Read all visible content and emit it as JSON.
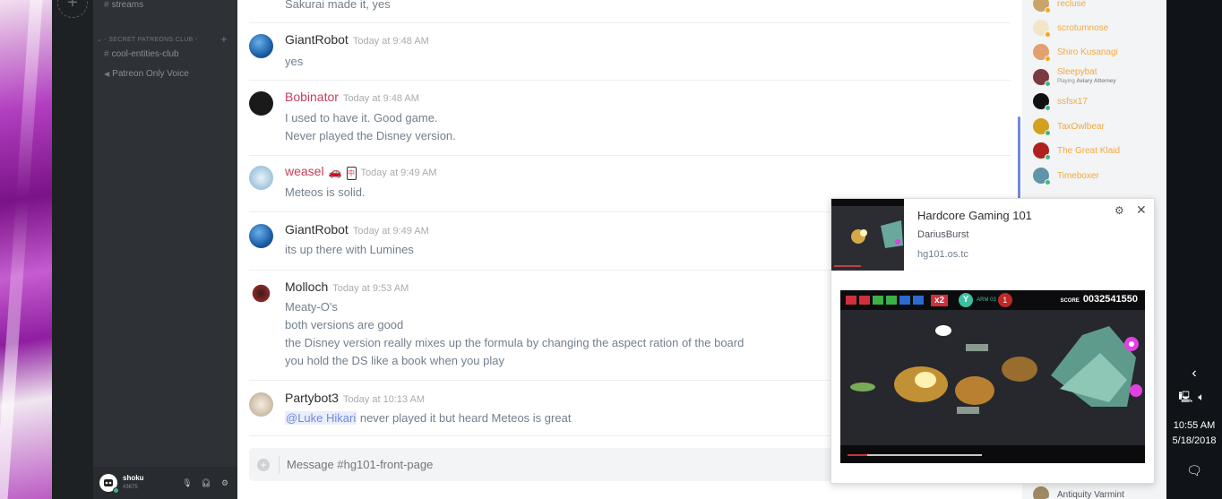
{
  "channels": {
    "top_item": "streams",
    "category": "- SECRET PATREONS CLUB -",
    "items": [
      {
        "label": "cool-entities-club"
      },
      {
        "label": "Patreon Only Voice"
      }
    ]
  },
  "user": {
    "name": "shoku",
    "tag": "#3675"
  },
  "messages": [
    {
      "name": "",
      "time": "",
      "lines": [
        "Sakurai made it, yes"
      ],
      "name_color": "#2d2f33"
    },
    {
      "name": "GiantRobot",
      "time": "Today at 9:48 AM",
      "lines": [
        "yes"
      ],
      "name_color": "#2d2f33"
    },
    {
      "name": "Bobinator",
      "time": "Today at 9:48 AM",
      "lines": [
        "I used to have it. Good game.",
        "Never played the Disney version."
      ],
      "name_color": "#c83e5a"
    },
    {
      "name": "weasel",
      "time": "Today at 9:49 AM",
      "lines": [
        "Meteos is solid."
      ],
      "name_color": "#c83e5a"
    },
    {
      "name": "GiantRobot",
      "time": "Today at 9:49 AM",
      "lines": [
        "its up there with Lumines"
      ],
      "name_color": "#2d2f33"
    },
    {
      "name": "Molloch",
      "time": "Today at 9:53 AM",
      "lines": [
        "Meaty-O's",
        "both versions are good",
        "the Disney version really mixes up the formula by changing the aspect ration of the board",
        "you hold the DS like a book when you play"
      ],
      "name_color": "#2d2f33"
    },
    {
      "name": "Partybot3",
      "time": "Today at 10:13 AM",
      "mention": "@Luke Hikari",
      "lines": [
        " never played it but heard Meteos is great"
      ],
      "name_color": "#2d2f33"
    }
  ],
  "composer": {
    "placeholder": "Message #hg101-front-page"
  },
  "members": [
    {
      "name": "recluse",
      "status": "#faa61a"
    },
    {
      "name": "scrotumnose",
      "status": "#faa61a"
    },
    {
      "name": "Shiro Kusanagi",
      "status": "#faa61a"
    },
    {
      "name": "Sleepybat",
      "status": "#43b581",
      "activity_prefix": "Playing",
      "activity": "Aviary Attorney"
    },
    {
      "name": "ssfsx17",
      "status": "#43b581"
    },
    {
      "name": "TaxOwlbear",
      "status": "#43b581"
    },
    {
      "name": "The Great Klaid",
      "status": "#43b581"
    },
    {
      "name": "Timeboxer",
      "status": "#43b581"
    },
    {
      "name": "Antiquity Varmint",
      "status": "#43b581"
    }
  ],
  "overlay": {
    "title": "Hardcore Gaming 101",
    "subtitle": "DariusBurst",
    "domain": "hg101.os.tc",
    "video": {
      "multiplier": "x2",
      "zone": "Y",
      "arm": "ARM 03",
      "lives": "1",
      "score_label": "SCORE",
      "score": "0032541550"
    }
  },
  "taskbar": {
    "time": "10:55 AM",
    "date": "5/18/2018"
  }
}
